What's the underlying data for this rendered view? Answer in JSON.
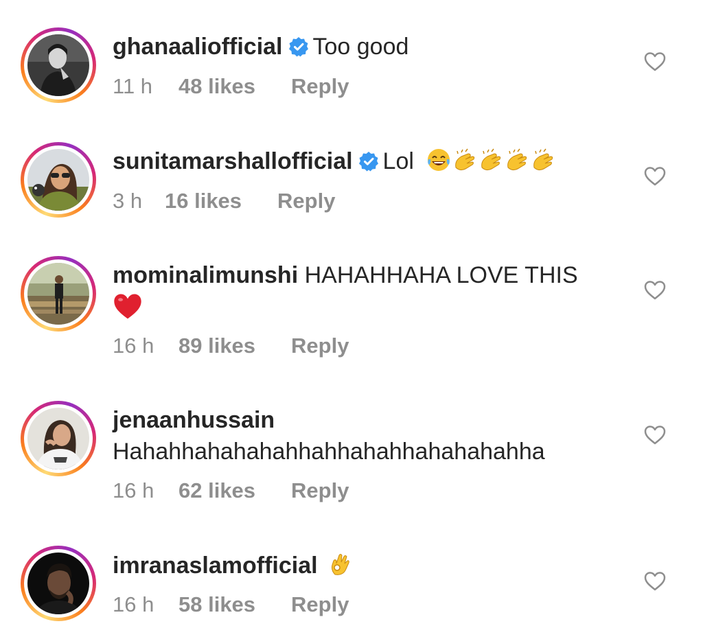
{
  "colors": {
    "username": "#262626",
    "meta": "#8e8e8e",
    "verified": "#3897f0",
    "heart_red": "#e0202f"
  },
  "comments": [
    {
      "username": "ghanaaliofficial",
      "verified": true,
      "text": "Too good",
      "time": "11 h",
      "likes": "48 likes",
      "reply": "Reply",
      "avatar": "woman-portrait-bw"
    },
    {
      "username": "sunitamarshallofficial",
      "verified": true,
      "text": "Lol",
      "emojis": [
        "tears-of-joy-emoji",
        "clapping-hands-emoji",
        "clapping-hands-emoji",
        "clapping-hands-emoji",
        "clapping-hands-emoji"
      ],
      "time": "3 h",
      "likes": "16 likes",
      "reply": "Reply",
      "avatar": "woman-sunglasses"
    },
    {
      "username": "mominalimunshi",
      "verified": false,
      "text": "HAHAHHAHA LOVE THIS",
      "emojis": [
        "red-heart-emoji"
      ],
      "time": "16 h",
      "likes": "89 likes",
      "reply": "Reply",
      "avatar": "person-outdoors"
    },
    {
      "username": "jenaanhussain",
      "verified": false,
      "text": "Hahahhahahahahhahhahahhahahahahha",
      "time": "16 h",
      "likes": "62 likes",
      "reply": "Reply",
      "avatar": "woman-white-shirt"
    },
    {
      "username": "imranaslamofficial",
      "verified": false,
      "text": "",
      "emojis": [
        "ok-hand-emoji"
      ],
      "time": "16 h",
      "likes": "58 likes",
      "reply": "Reply",
      "avatar": "man-dark-portrait"
    }
  ]
}
